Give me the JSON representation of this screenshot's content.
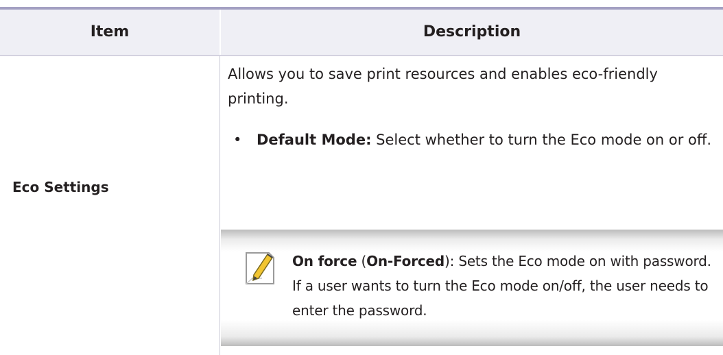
{
  "table": {
    "headers": {
      "item": "Item",
      "description": "Description"
    },
    "row": {
      "item": "Eco Settings",
      "description": {
        "intro": "Allows you to save print resources and enables eco-friendly printing.",
        "bullet": {
          "term": "Default Mode:",
          "text": " Select whether to turn the Eco mode on or off."
        },
        "note": {
          "term": "On force",
          "open_paren": " (",
          "term2": "On-Forced",
          "text": "): Sets the Eco mode on with password. If a user wants to turn the Eco mode on/off, the user needs to enter the password."
        }
      }
    }
  },
  "colors": {
    "accent_rule": "#a3a0c2",
    "header_bg": "#efeff5"
  },
  "icons": {
    "note": "note-pencil-icon",
    "bullet": "bullet-dot"
  }
}
